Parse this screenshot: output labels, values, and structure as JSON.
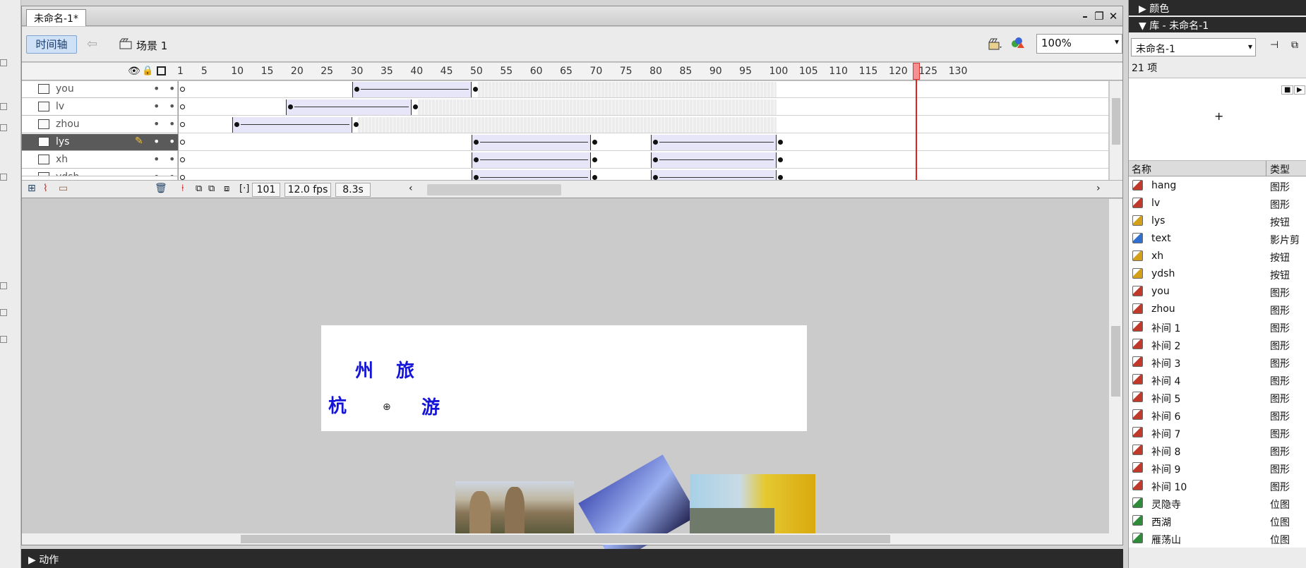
{
  "document": {
    "tab_title": "未命名-1*"
  },
  "timeline": {
    "timeline_button": "时间轴",
    "scene": "场景 1",
    "zoom": "100%",
    "ruler_ticks": [
      "1",
      "5",
      "10",
      "15",
      "20",
      "25",
      "30",
      "35",
      "40",
      "45",
      "50",
      "55",
      "60",
      "65",
      "70",
      "75",
      "80",
      "85",
      "90",
      "95",
      "100",
      "105",
      "110",
      "115",
      "120",
      "125",
      "130"
    ],
    "layers": [
      {
        "name": "you",
        "color": "#33ddee"
      },
      {
        "name": "lv",
        "color": "#f2ef1a"
      },
      {
        "name": "zhou",
        "color": "#9a33cc"
      },
      {
        "name": "lys",
        "color": "#e83a3a"
      },
      {
        "name": "xh",
        "color": "#3366dd"
      },
      {
        "name": "ydsh",
        "color": "#888888"
      }
    ],
    "current_frame": "101",
    "fps": "12.0 fps",
    "elapsed": "8.3s"
  },
  "stage": {
    "chars": [
      "州",
      "旅",
      "杭",
      "游"
    ]
  },
  "panels": {
    "color_title": "颜色",
    "library_title": "库 - 未命名-1",
    "actions_title": "动作"
  },
  "library": {
    "doc_select": "未命名-1",
    "count": "21 项",
    "col_name": "名称",
    "col_type": "类型",
    "items": [
      {
        "name": "hang",
        "type": "图形",
        "kind": "graphic"
      },
      {
        "name": "lv",
        "type": "图形",
        "kind": "graphic"
      },
      {
        "name": "lys",
        "type": "按钮",
        "kind": "button"
      },
      {
        "name": "text",
        "type": "影片剪",
        "kind": "movie"
      },
      {
        "name": "xh",
        "type": "按钮",
        "kind": "button"
      },
      {
        "name": "ydsh",
        "type": "按钮",
        "kind": "button"
      },
      {
        "name": "you",
        "type": "图形",
        "kind": "graphic"
      },
      {
        "name": "zhou",
        "type": "图形",
        "kind": "graphic"
      },
      {
        "name": "补间 1",
        "type": "图形",
        "kind": "graphic"
      },
      {
        "name": "补间 2",
        "type": "图形",
        "kind": "graphic"
      },
      {
        "name": "补间 3",
        "type": "图形",
        "kind": "graphic"
      },
      {
        "name": "补间 4",
        "type": "图形",
        "kind": "graphic"
      },
      {
        "name": "补间 5",
        "type": "图形",
        "kind": "graphic"
      },
      {
        "name": "补间 6",
        "type": "图形",
        "kind": "graphic"
      },
      {
        "name": "补间 7",
        "type": "图形",
        "kind": "graphic"
      },
      {
        "name": "补间 8",
        "type": "图形",
        "kind": "graphic"
      },
      {
        "name": "补间 9",
        "type": "图形",
        "kind": "graphic"
      },
      {
        "name": "补间 10",
        "type": "图形",
        "kind": "graphic"
      },
      {
        "name": "灵隐寺",
        "type": "位图",
        "kind": "bitmap"
      },
      {
        "name": "西湖",
        "type": "位图",
        "kind": "bitmap"
      },
      {
        "name": "雁荡山",
        "type": "位图",
        "kind": "bitmap"
      }
    ]
  }
}
